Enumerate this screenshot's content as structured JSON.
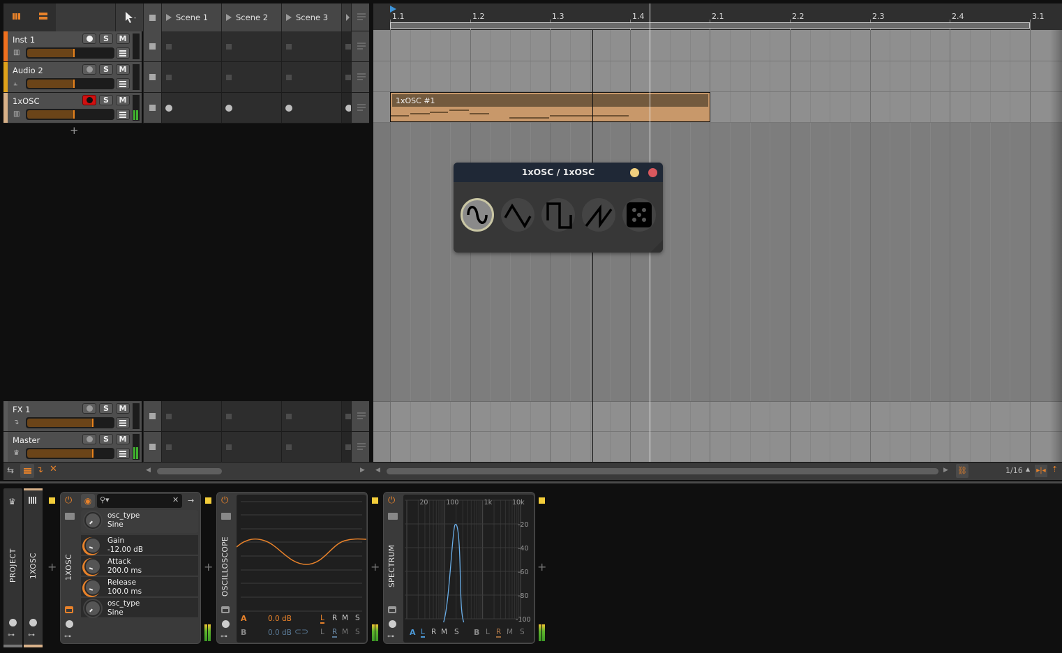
{
  "header": {
    "grid_view_icon": "grid-icon",
    "list_view_icon": "list-icon",
    "tool": "pointer-tool",
    "scenes": [
      "Scene 1",
      "Scene 2",
      "Scene 3"
    ]
  },
  "tracks": [
    {
      "name": "Inst 1",
      "color": "#f0701e",
      "type_icon": "piano-icon",
      "arm": "on-white",
      "solo": "S",
      "mute": "M",
      "volume": 0.55,
      "meter": 0,
      "clips": [
        "empty",
        "empty",
        "empty"
      ]
    },
    {
      "name": "Audio 2",
      "color": "#e0a21a",
      "type_icon": "waveform-icon",
      "arm": "off",
      "solo": "S",
      "mute": "M",
      "volume": 0.55,
      "meter": 0,
      "clips": [
        "empty",
        "empty",
        "empty"
      ]
    },
    {
      "name": "1xOSC",
      "color": "#d8b189",
      "type_icon": "piano-icon",
      "arm": "recording",
      "solo": "S",
      "mute": "M",
      "volume": 0.55,
      "meter": 0.4,
      "clips": [
        "record",
        "record",
        "record"
      ]
    }
  ],
  "add_track_label": "+",
  "fx_tracks": [
    {
      "name": "FX 1",
      "type_icon": "return-icon",
      "solo": "S",
      "mute": "M",
      "volume": 0.77,
      "meter": 0
    },
    {
      "name": "Master",
      "type_icon": "crown-icon",
      "solo": "S",
      "mute": "M",
      "volume": 0.77,
      "meter": 0.5
    }
  ],
  "arranger": {
    "ruler": [
      "1.1",
      "1.2",
      "1.3",
      "1.4",
      "2.1",
      "2.2",
      "2.3",
      "2.4",
      "3.1"
    ],
    "clip": {
      "name": "1xOSC #1"
    },
    "grid": "1/16"
  },
  "popup": {
    "title": "1xOSC / 1xOSC",
    "waveforms": [
      "sine",
      "triangle",
      "square",
      "saw",
      "random"
    ],
    "selected": "sine"
  },
  "bottom_toolbar": {
    "icons": [
      "swap-icon",
      "list-columns-icon",
      "return-arrow-icon",
      "close-icon"
    ],
    "grid_value": "1/16"
  },
  "device_chain": {
    "project_label": "PROJECT",
    "track_label": "1XOSC",
    "instrument": {
      "name": "1XOSC",
      "search_placeholder": "",
      "params": [
        {
          "name": "osc_type",
          "value": "Sine"
        },
        {
          "name": "Gain",
          "value": "-12.00 dB"
        },
        {
          "name": "Attack",
          "value": "200.0 ms"
        },
        {
          "name": "Release",
          "value": "100.0 ms"
        },
        {
          "name": "osc_type",
          "value": "Sine"
        }
      ]
    },
    "oscilloscope": {
      "name": "OSCILLOSCOPE",
      "a_label": "A",
      "a_gain": "0.0 dB",
      "b_label": "B",
      "b_gain": "0.0 dB",
      "channels": [
        "L",
        "R",
        "M",
        "S"
      ],
      "a_selected": "L",
      "b_selected": "R"
    },
    "spectrum": {
      "name": "SPECTRUM",
      "freq_labels": [
        "20",
        "100",
        "1k",
        "10k"
      ],
      "db_labels": [
        "-20",
        "-40",
        "-60",
        "-80",
        "-100"
      ],
      "a_label": "A",
      "b_label": "B",
      "channels": [
        "L",
        "R",
        "M",
        "S"
      ],
      "a_selected": "L",
      "b_selected": "R"
    }
  }
}
